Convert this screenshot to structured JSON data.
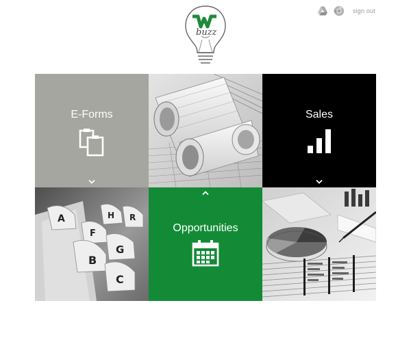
{
  "brand": {
    "logo_text": "buzz",
    "logo_letter": "W"
  },
  "header": {
    "signout_label": "sign out",
    "icons": [
      "drive-icon",
      "chrome-icon"
    ]
  },
  "tiles": [
    {
      "label": "E-Forms",
      "icon": "clipboard-icon",
      "color": "#a4a69f",
      "expander": "chevron-down-icon"
    },
    {
      "image": "blueprint-rolls"
    },
    {
      "label": "Sales",
      "icon": "bar-chart-icon",
      "color": "#000000",
      "expander": "chevron-down-icon"
    },
    {
      "image": "file-index-tabs",
      "tab_letters": [
        "A",
        "B",
        "C",
        "F",
        "G",
        "H",
        "R"
      ]
    },
    {
      "label": "Opportunities",
      "icon": "calendar-icon",
      "color": "#138b36",
      "expander": "chevron-up-icon"
    },
    {
      "image": "report-charts"
    }
  ],
  "colors": {
    "eforms_bg": "#a4a69f",
    "sales_bg": "#000000",
    "opportunities_bg": "#138b36",
    "brand_green": "#1f8a3b"
  }
}
